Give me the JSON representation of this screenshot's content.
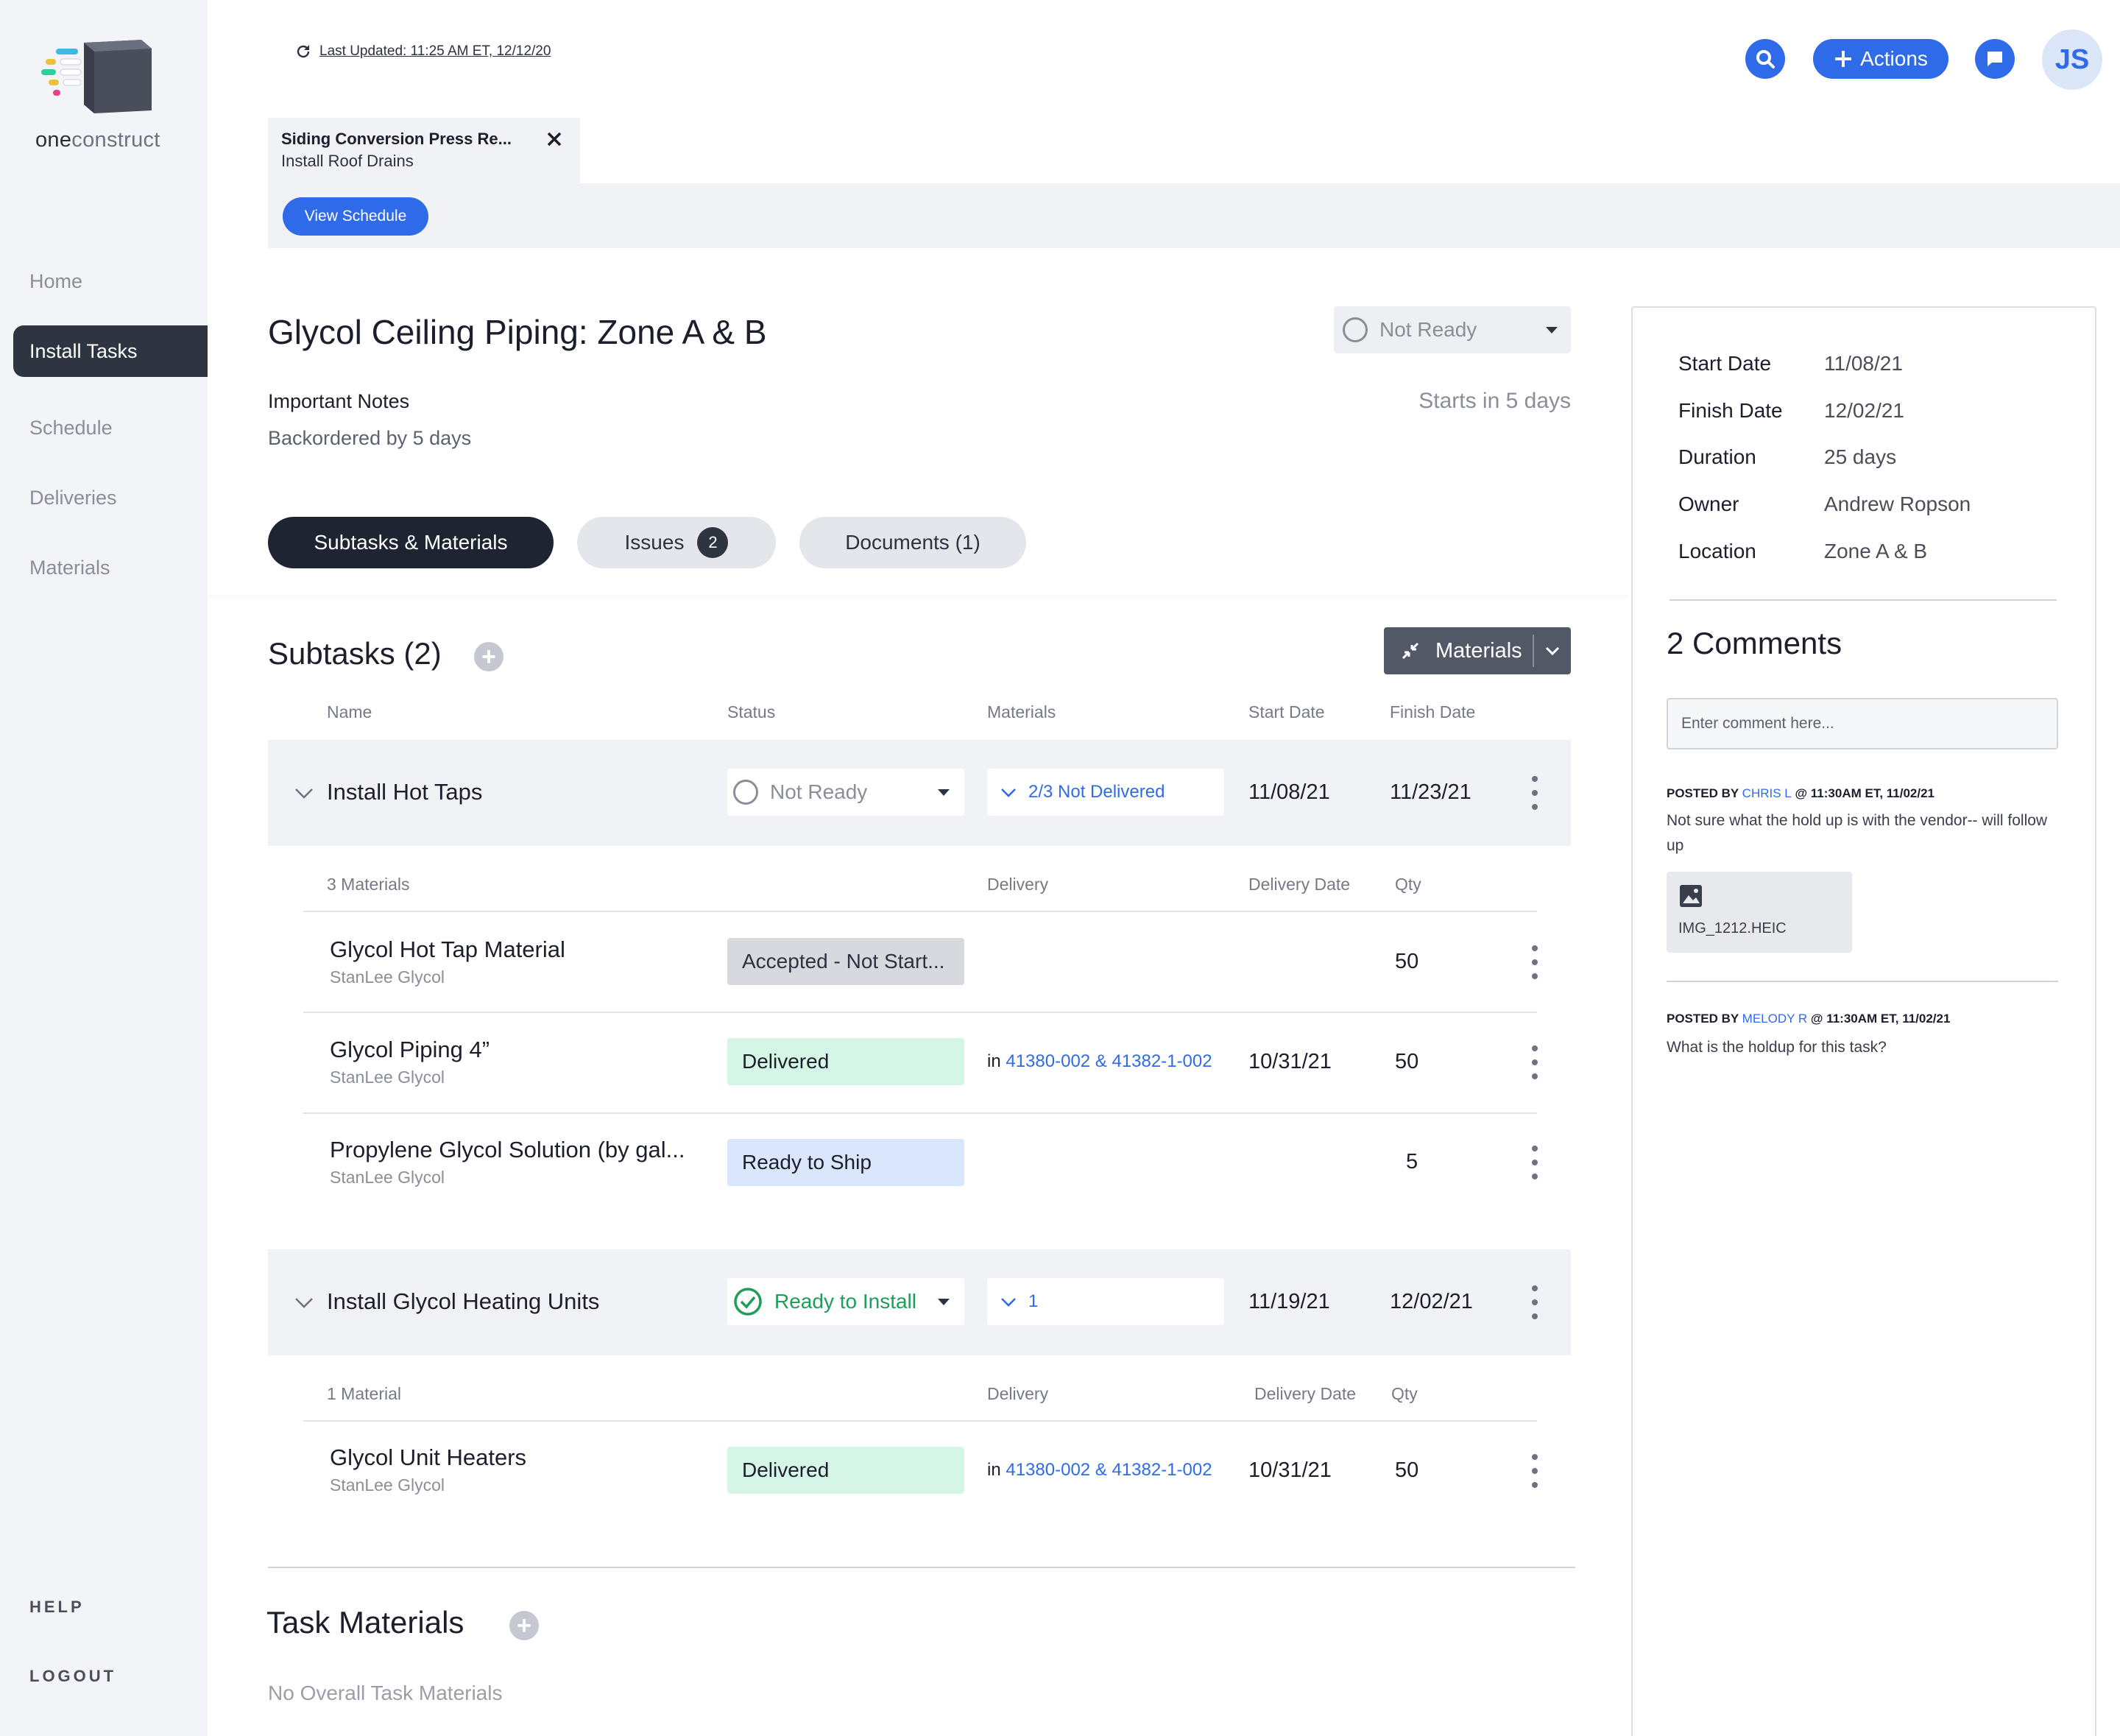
{
  "app": {
    "brand_prefix": "one",
    "brand_suffix": "construct",
    "last_updated": "Last Updated: 11:25 AM ET, 12/12/20",
    "actions_label": "Actions",
    "avatar_initials": "JS"
  },
  "sidebar": {
    "items": [
      {
        "label": "Home"
      },
      {
        "label": "Install Tasks",
        "active": true
      },
      {
        "label": "Schedule"
      },
      {
        "label": "Deliveries"
      },
      {
        "label": "Materials"
      }
    ],
    "help": "HELP",
    "logout": "LOGOUT"
  },
  "tab": {
    "title": "Siding Conversion Press Re...",
    "subtitle": "Install Roof Drains",
    "view_schedule": "View Schedule"
  },
  "task": {
    "title": "Glycol Ceiling Piping: Zone A & B",
    "status": "Not Ready",
    "notes_label": "Important Notes",
    "notes_value": "Backordered by 5 days",
    "starts": "Starts in 5 days",
    "tabs": [
      {
        "label": "Subtasks & Materials"
      },
      {
        "label": "Issues",
        "badge": "2"
      },
      {
        "label": "Documents (1)"
      }
    ]
  },
  "subtasks": {
    "title": "Subtasks (2)",
    "materials_button": "Materials",
    "columns": [
      "Name",
      "Status",
      "Materials",
      "Start Date",
      "Finish Date"
    ],
    "rows": [
      {
        "name": "Install Hot Taps",
        "status": "Not Ready",
        "materials": "2/3 Not Delivered",
        "start": "11/08/21",
        "finish": "11/23/21",
        "mat_header": {
          "count": "3 Materials",
          "delivery": "Delivery",
          "date": "Delivery Date",
          "qty": "Qty"
        },
        "items": [
          {
            "name": "Glycol Hot Tap Material",
            "vendor": "StanLee Glycol",
            "status": "Accepted - Not Start...",
            "delivery_prefix": "",
            "delivery_link": "",
            "date": "",
            "qty": "50"
          },
          {
            "name": "Glycol Piping 4”",
            "vendor": "StanLee Glycol",
            "status": "Delivered",
            "delivery_prefix": "in",
            "delivery_link": "41380-002 & 41382-1-002",
            "date": "10/31/21",
            "qty": "50"
          },
          {
            "name": "Propylene Glycol Solution (by gal...",
            "vendor": "StanLee Glycol",
            "status": "Ready to Ship",
            "delivery_prefix": "",
            "delivery_link": "",
            "date": "",
            "qty": "5"
          }
        ]
      },
      {
        "name": "Install Glycol Heating Units",
        "status": "Ready to Install",
        "materials": "1",
        "start": "11/19/21",
        "finish": "12/02/21",
        "mat_header": {
          "count": "1 Material",
          "delivery": "Delivery",
          "date": "Delivery Date",
          "qty": "Qty"
        },
        "items": [
          {
            "name": "Glycol Unit Heaters",
            "vendor": "StanLee Glycol",
            "status": "Delivered",
            "delivery_prefix": "in",
            "delivery_link": "41380-002 & 41382-1-002",
            "date": "10/31/21",
            "qty": "50"
          }
        ]
      }
    ]
  },
  "task_materials": {
    "title": "Task Materials",
    "empty": "No Overall Task Materials"
  },
  "details": {
    "start_label": "Start Date",
    "start": "11/08/21",
    "finish_label": "Finish Date",
    "finish": "12/02/21",
    "duration_label": "Duration",
    "duration": "25 days",
    "owner_label": "Owner",
    "owner": "Andrew Ropson",
    "location_label": "Location",
    "location": "Zone A & B"
  },
  "comments": {
    "title": "2 Comments",
    "placeholder": "Enter comment here...",
    "items": [
      {
        "posted_by": "POSTED BY",
        "author": "CHRIS L",
        "when": "@ 11:30AM ET, 11/02/21",
        "text": "Not sure what the hold up is with the vendor-- will follow up",
        "attachment": "IMG_1212.HEIC"
      },
      {
        "posted_by": "POSTED BY",
        "author": "MELODY R",
        "when": "@ 11:30AM ET, 11/02/21",
        "text": "What is the holdup for this task?"
      }
    ]
  },
  "colors": {
    "accent": "#2f6be8",
    "sidebar_active": "#2f3441",
    "delivered_bg": "#d5f5e6",
    "ready_ship_bg": "#d9e6fb",
    "accepted_bg": "#d7d9de",
    "ready_install": "#1f9d5a"
  }
}
